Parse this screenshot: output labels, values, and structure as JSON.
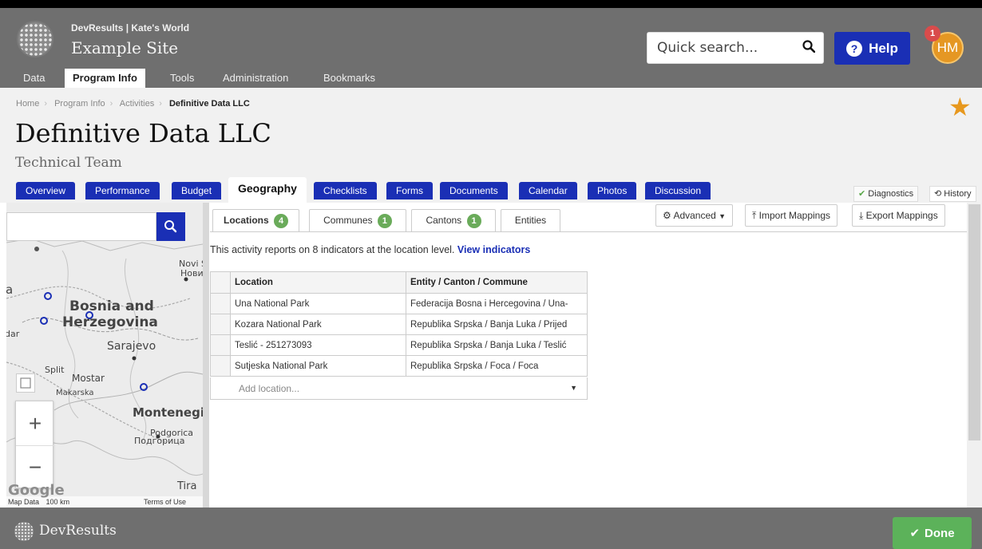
{
  "header": {
    "org_line": "DevResults | Kate's World",
    "site_name": "Example Site",
    "search_placeholder": "Quick search...",
    "help_label": "Help",
    "avatar_initials": "HM",
    "notification_count": "1"
  },
  "nav": [
    "Data",
    "Program Info",
    "Tools",
    "Administration",
    "Bookmarks"
  ],
  "breadcrumb": [
    "Home",
    "Program Info",
    "Activities",
    "Definitive Data LLC"
  ],
  "page": {
    "title": "Definitive Data LLC",
    "subtitle": "Technical Team"
  },
  "tabs": [
    "Overview",
    "Performance",
    "Budget",
    "Geography",
    "Checklists",
    "Forms",
    "Documents",
    "Calendar",
    "Photos",
    "Discussion"
  ],
  "active_tab": "Geography",
  "side_buttons": {
    "diagnostics": "Diagnostics",
    "history": "History"
  },
  "map": {
    "labels": {
      "bosnia": "Bosnia and",
      "herzegovina": "Herzegovina",
      "sarajevo": "Sarajevo",
      "split": "Split",
      "mostar": "Mostar",
      "makarska": "Makarska",
      "montenegro": "Montenegi",
      "podgorica": "Podgorica",
      "podgorica_cyr": "Подгорица",
      "novi": "Novi S",
      "novi_cyr": "Нови",
      "tirana": "Tira",
      "a": "a",
      "dar": "dar"
    },
    "attribution": "Map Data",
    "scale": "100 km",
    "terms": "Terms of Use",
    "google": "Google"
  },
  "subtabs": [
    {
      "label": "Locations",
      "count": "4"
    },
    {
      "label": "Communes",
      "count": "1"
    },
    {
      "label": "Cantons",
      "count": "1"
    },
    {
      "label": "Entities",
      "count": ""
    }
  ],
  "toolbar": {
    "advanced": "Advanced",
    "import": "Import Mappings",
    "export": "Export Mappings"
  },
  "info": {
    "text": "This activity reports on 8 indicators at the location level.",
    "link": "View indicators"
  },
  "table": {
    "headers": [
      "Location",
      "Entity / Canton / Commune"
    ],
    "rows": [
      [
        "Una National Park",
        "Federacija Bosna i Hercegovina / Una-"
      ],
      [
        "Kozara National Park",
        "Republika Srpska / Banja Luka / Prijed"
      ],
      [
        "Teslić - 251273093",
        "Republika Srpska / Banja Luka / Teslić"
      ],
      [
        "Sutjeska National Park",
        "Republika Srpska / Foca / Foca"
      ]
    ],
    "add_placeholder": "Add location..."
  },
  "footer": {
    "brand": "DevResults",
    "done_label": "Done"
  },
  "colors": {
    "header_gray": "#6f6f6f",
    "tab_blue": "#1a2fb5",
    "badge_green": "#6aab5a",
    "done_green": "#5cb25a",
    "star_orange": "#e7981e",
    "avatar_orange": "#e59723"
  },
  "icons": [
    "search-icon",
    "question-icon",
    "star-icon",
    "gear-icon",
    "caret-down-icon",
    "upload-icon",
    "download-icon",
    "check-icon",
    "history-icon",
    "fullscreen-icon",
    "zoom-in-icon",
    "zoom-out-icon"
  ]
}
